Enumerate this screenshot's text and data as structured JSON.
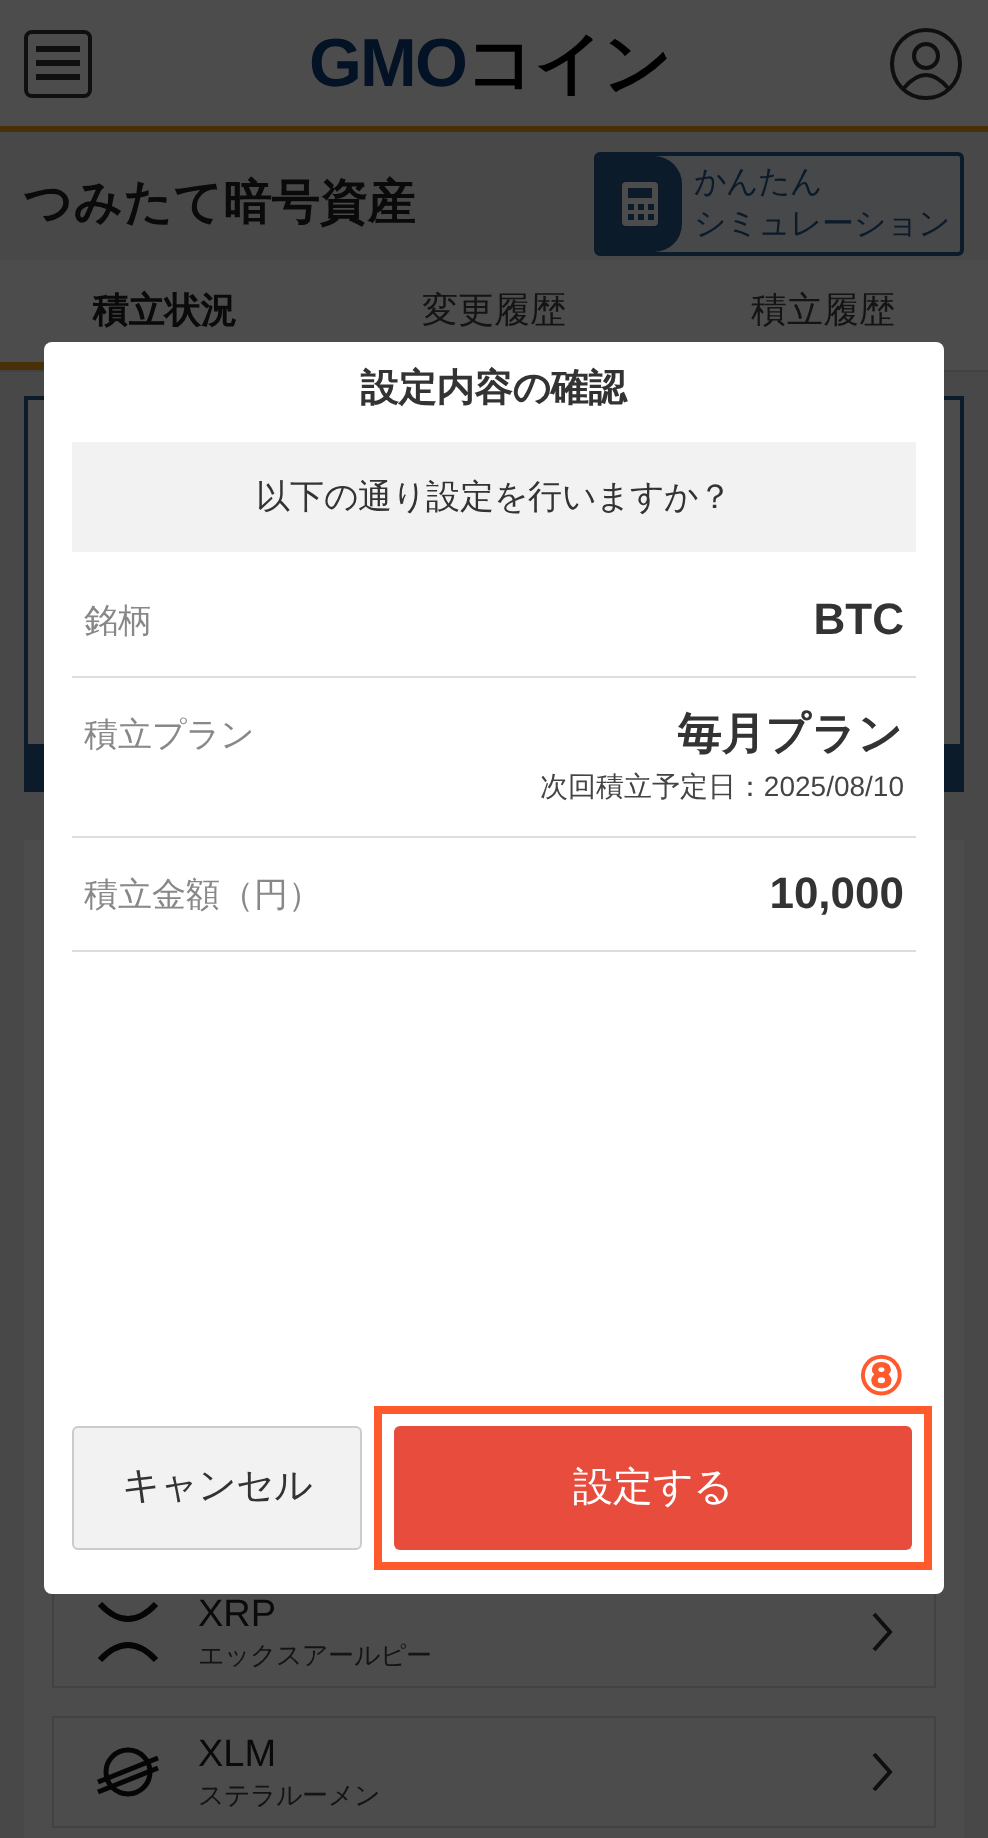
{
  "header": {
    "logo": {
      "latin": "GMO",
      "kana": "コイン"
    }
  },
  "page_title": "つみたて暗号資産",
  "simulation_button": {
    "line_1": "かんたん",
    "line_2": "シミュレーション"
  },
  "tabs": [
    {
      "label": "積立状況",
      "selected": true
    },
    {
      "label": "変更履歴",
      "selected": false
    },
    {
      "label": "積立履歴",
      "selected": false
    }
  ],
  "coins": [
    {
      "kind": "xrp",
      "symbol": "XRP",
      "name": "エックスアールピー"
    },
    {
      "kind": "xlm",
      "symbol": "XLM",
      "name": "ステラルーメン"
    }
  ],
  "dialog": {
    "title": "設定内容の確認",
    "question": "以下の通り設定を行いますか？",
    "rows": [
      {
        "label": "銘柄",
        "value": "BTC"
      },
      {
        "label": "積立プラン",
        "value": "毎月プラン",
        "note": "次回積立予定日：2025/08/10"
      },
      {
        "label": "積立金額（円）",
        "value": "10,000"
      }
    ],
    "cancel_button": "キャンセル",
    "confirm_button": "設定する",
    "step_marker": "⑧"
  }
}
